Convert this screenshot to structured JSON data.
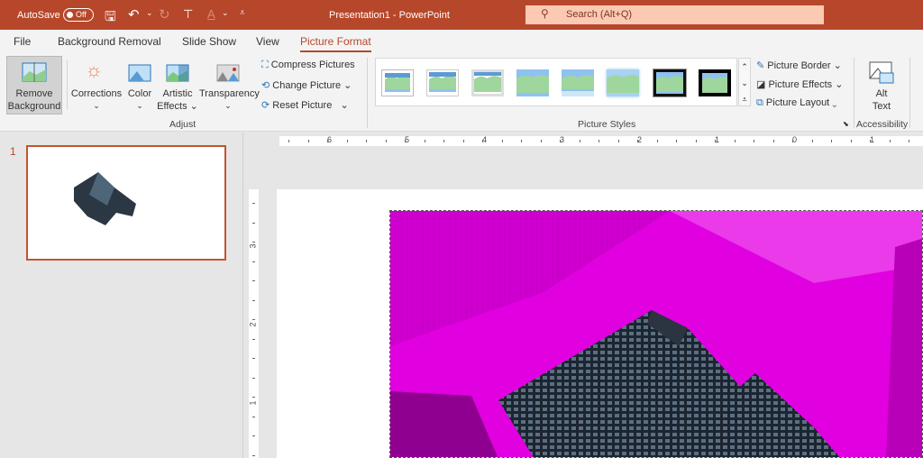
{
  "titlebar": {
    "autosave": "AutoSave",
    "autosave_state": "Off",
    "title": "Presentation1  -  PowerPoint",
    "search_placeholder": "Search (Alt+Q)"
  },
  "tabs": [
    "File",
    "Background Removal",
    "Slide Show",
    "View",
    "Picture Format"
  ],
  "ribbon": {
    "remove_bg": [
      "Remove",
      "Background"
    ],
    "corrections": "Corrections",
    "color": "Color",
    "artistic": [
      "Artistic",
      "Effects"
    ],
    "transparency": "Transparency",
    "compress": "Compress Pictures",
    "change": "Change Picture",
    "reset": "Reset Picture",
    "adjust_group": "Adjust",
    "styles_group": "Picture Styles",
    "border": "Picture Border",
    "effects": "Picture Effects",
    "layout": "Picture Layout",
    "alt": [
      "Alt",
      "Text"
    ],
    "access_group": "Accessibility"
  },
  "slides": {
    "number": "1"
  },
  "ruler": {
    "h": [
      "6",
      "5",
      "4",
      "3",
      "2",
      "1",
      "0",
      "1"
    ],
    "v": [
      "3",
      "2",
      "1"
    ]
  },
  "colors": {
    "accent": "#b7472a",
    "image": "#e600e6"
  }
}
